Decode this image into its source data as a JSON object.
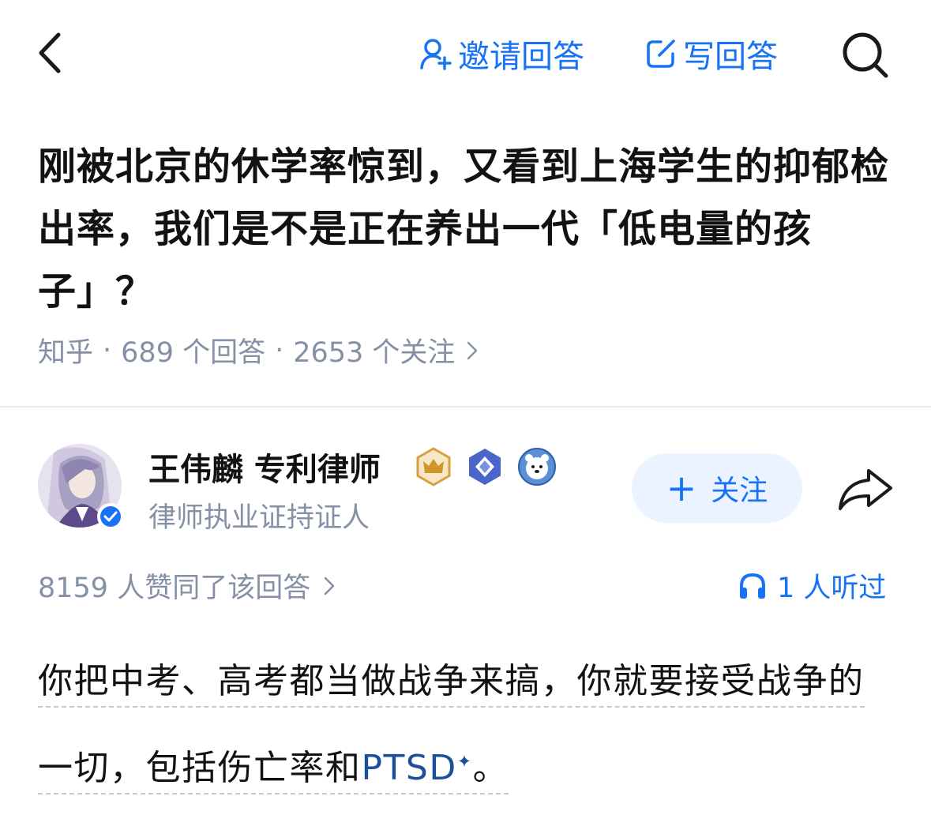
{
  "nav": {
    "invite_label": "邀请回答",
    "write_label": "写回答",
    "accent_color": "#1772f6"
  },
  "question": {
    "title": "刚被北京的休学率惊到，又看到上海学生的抑郁检出率，我们是不是正在养出一代「低电量的孩子」？",
    "source": "知乎",
    "answers_count": "689 个回答",
    "followers_count": "2653 个关注"
  },
  "author": {
    "name": "王伟麟 专利律师",
    "title": "律师执业证持证人",
    "badges": [
      "crown-badge",
      "diamond-badge",
      "bear-badge"
    ],
    "follow_label": "关注"
  },
  "stats": {
    "votes": "8159 人赞同了该回答",
    "listens": "1 人听过"
  },
  "answer": {
    "part1": "你把中考、高考都当做战争来搞，你就要接受战争的一切，包括伤亡率和",
    "keyword": "PTSD",
    "part2": "。"
  }
}
